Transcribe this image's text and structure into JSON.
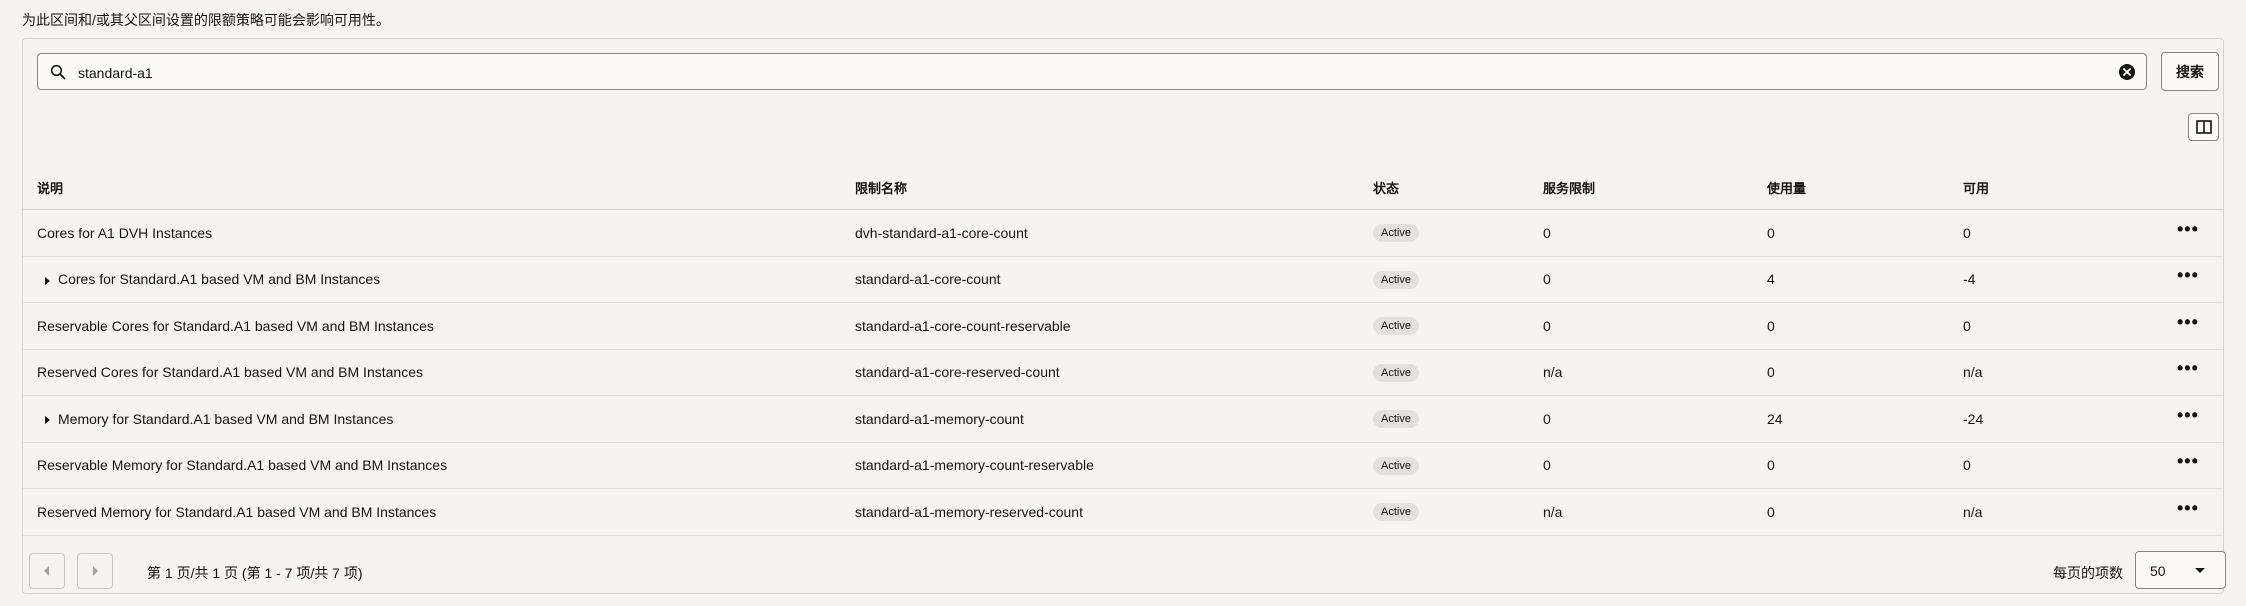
{
  "notice": "为此区间和/或其父区间设置的限额策略可能会影响可用性。",
  "search": {
    "value": "standard-a1",
    "button_label": "搜索"
  },
  "icons": {
    "search": "search-icon",
    "clear": "clear-circle-icon",
    "columns": "columns-icon",
    "expand": "caret-right-icon",
    "more": "ellipsis-icon",
    "prev": "chevron-left-icon",
    "next": "chevron-right-icon"
  },
  "table": {
    "headers": [
      "说明",
      "限制名称",
      "状态",
      "服务限制",
      "使用量",
      "可用"
    ],
    "rows": [
      {
        "desc": "Cores for A1 DVH Instances",
        "expandable": false,
        "name": "dvh-standard-a1-core-count",
        "status": "Active",
        "limit": "0",
        "usage": "0",
        "available": "0",
        "more": "•••"
      },
      {
        "desc": "Cores for Standard.A1 based VM and BM Instances",
        "expandable": true,
        "name": "standard-a1-core-count",
        "status": "Active",
        "limit": "0",
        "usage": "4",
        "available": "-4",
        "more": "•••"
      },
      {
        "desc": "Reservable Cores for Standard.A1 based VM and BM Instances",
        "expandable": false,
        "name": "standard-a1-core-count-reservable",
        "status": "Active",
        "limit": "0",
        "usage": "0",
        "available": "0",
        "more": "•••"
      },
      {
        "desc": "Reserved Cores for Standard.A1 based VM and BM Instances",
        "expandable": false,
        "name": "standard-a1-core-reserved-count",
        "status": "Active",
        "limit": "n/a",
        "usage": "0",
        "available": "n/a",
        "more": "•••"
      },
      {
        "desc": "Memory for Standard.A1 based VM and BM Instances",
        "expandable": true,
        "name": "standard-a1-memory-count",
        "status": "Active",
        "limit": "0",
        "usage": "24",
        "available": "-24",
        "more": "•••"
      },
      {
        "desc": "Reservable Memory for Standard.A1 based VM and BM Instances",
        "expandable": false,
        "name": "standard-a1-memory-count-reservable",
        "status": "Active",
        "limit": "0",
        "usage": "0",
        "available": "0",
        "more": "•••"
      },
      {
        "desc": "Reserved Memory for Standard.A1 based VM and BM Instances",
        "expandable": false,
        "name": "standard-a1-memory-reserved-count",
        "status": "Active",
        "limit": "n/a",
        "usage": "0",
        "available": "n/a",
        "more": "•••"
      }
    ]
  },
  "pagination": {
    "info": "第 1 页/共 1 页 (第 1 - 7 项/共 7 项)",
    "per_page_label": "每页的项数",
    "per_page_value": "50"
  }
}
